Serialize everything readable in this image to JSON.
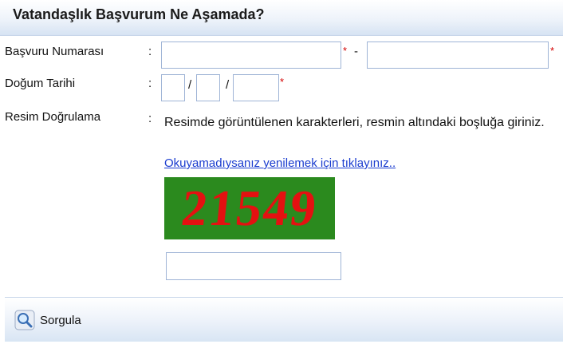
{
  "header": {
    "title": "Vatandaşlık Başvurum Ne Aşamada?"
  },
  "form": {
    "application_number": {
      "label": "Başvuru Numarası",
      "colon": ":",
      "part1_value": "",
      "part2_value": "",
      "separator": "-",
      "required_mark": "*"
    },
    "birth_date": {
      "label": "Doğum Tarihi",
      "colon": ":",
      "day_value": "",
      "month_value": "",
      "year_value": "",
      "separator": "/",
      "required_mark": "*"
    },
    "captcha_section": {
      "label": "Resim Doğrulama",
      "colon": ":",
      "instructions": "Resimde görüntülenen karakterleri, resmin altındaki boşluğa giriniz.",
      "refresh_link": "Okuyamadıysanız yenilemek için tıklayınız..",
      "captcha_text": "21549",
      "answer_value": ""
    }
  },
  "footer": {
    "query_button_label": "Sorgula",
    "query_icon": "magnifier-icon"
  },
  "colors": {
    "required": "#d40000",
    "link": "#1a3ccf",
    "captcha_bg": "#2b8a1e",
    "captcha_fg": "#e41111"
  }
}
